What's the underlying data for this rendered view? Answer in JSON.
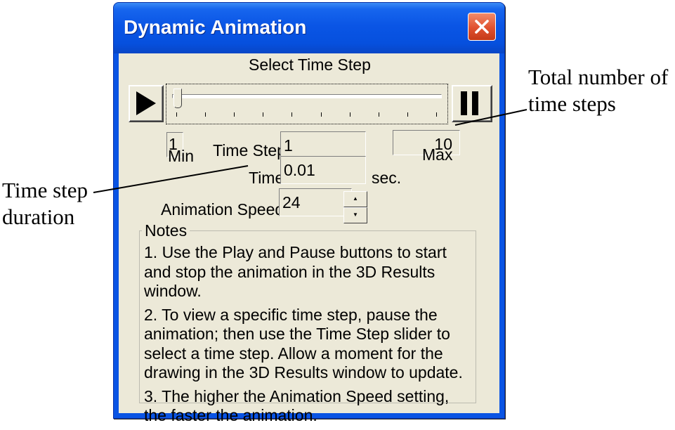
{
  "window": {
    "title": "Dynamic Animation",
    "close_icon": "close-x-icon"
  },
  "slider": {
    "heading": "Select Time Step",
    "play_icon": "play-icon",
    "pause_icon": "pause-icon",
    "current_fraction": 0
  },
  "time_step": {
    "min_value": "1",
    "min_label": "Min",
    "label": "Time Step",
    "value": "1",
    "max_value": "10",
    "max_label": "Max"
  },
  "time": {
    "label": "Time",
    "value": "0.01",
    "unit": "sec."
  },
  "speed": {
    "label": "Animation Speed",
    "value": "24",
    "up_icon": "spin-up-icon",
    "down_icon": "spin-down-icon"
  },
  "notes": {
    "title": "Notes",
    "items": [
      "1.  Use the Play and Pause buttons to start and stop the animation in the 3D Results window.",
      "2.  To view a specific time step, pause the animation; then use the Time Step slider to select a time step.  Allow a moment for the drawing in the 3D Results window to update.",
      "3.  The higher the Animation Speed setting, the faster the animation."
    ]
  },
  "annotations": {
    "total_steps_line1": "Total number of",
    "total_steps_line2": "time steps",
    "duration_line1": "Time step",
    "duration_line2": "duration"
  },
  "colors": {
    "titlebar": "#0a55e5",
    "dialog_face": "#ece9d8",
    "close_button": "#e0512f"
  }
}
